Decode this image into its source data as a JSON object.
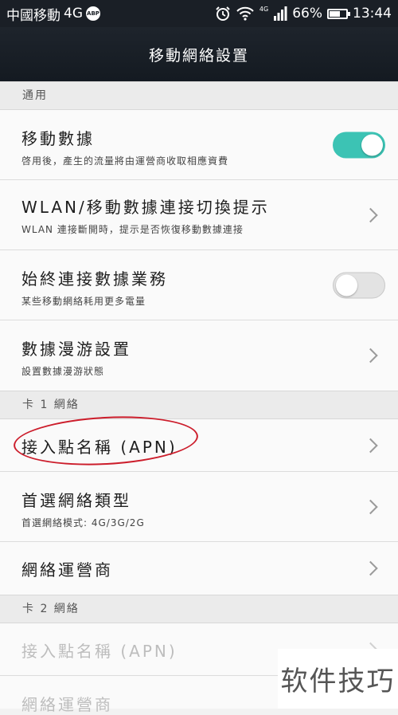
{
  "status_bar": {
    "carrier": "中國移動",
    "network": "4G",
    "abp": "ABP",
    "signal_tag": "4G",
    "battery": "66%",
    "battery_level": 0.66,
    "time": "13:44"
  },
  "header": {
    "title": "移動網絡設置"
  },
  "sections": [
    {
      "label": "通用"
    },
    {
      "label": "卡 1 網絡"
    },
    {
      "label": "卡 2 網絡"
    }
  ],
  "rows": [
    {
      "title": "移動數據",
      "subtitle": "啓用後，產生的流量將由運營商收取相應資費",
      "toggle": "on"
    },
    {
      "title": "WLAN/移動數據連接切換提示",
      "subtitle": "WLAN 連接斷開時，提示是否恢復移動數據連接"
    },
    {
      "title": "始終連接數據業務",
      "subtitle": "某些移動網絡耗用更多電量",
      "toggle": "off"
    },
    {
      "title": "數據漫游設置",
      "subtitle": "設置數據漫游狀態"
    },
    {
      "title": "接入點名稱 (APN)"
    },
    {
      "title": "首選網絡類型",
      "subtitle": "首選網絡模式: 4G/3G/2G"
    },
    {
      "title": "網絡運營商"
    },
    {
      "title": "接入點名稱 (APN)"
    },
    {
      "title": "網絡運營商"
    }
  ],
  "watermark": "软件技巧",
  "colors": {
    "accent": "#3cc3b4",
    "annotation": "#cc1d2b",
    "status_bar": "#1a1f26"
  }
}
